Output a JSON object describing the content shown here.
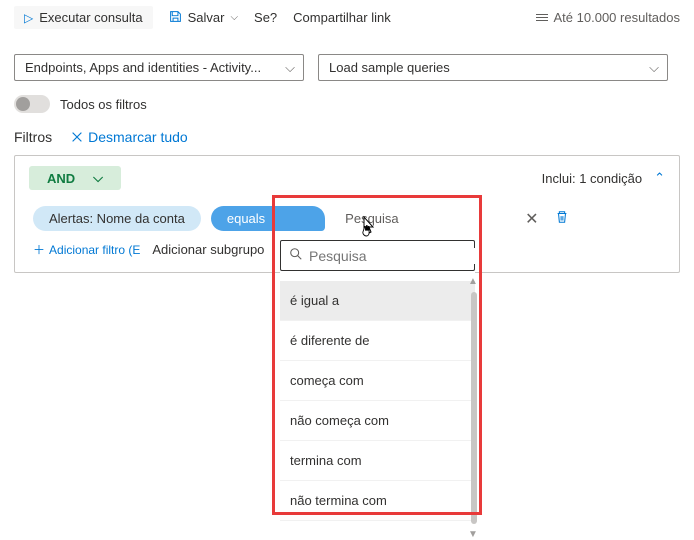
{
  "toolbar": {
    "run_query": "Executar consulta",
    "save": "Salvar",
    "se": "Se?",
    "share_link": "Compartilhar link",
    "results_limit": "Até 10.000 resultados"
  },
  "dropdowns": {
    "scope": "Endpoints, Apps and identities - Activity...",
    "sample_queries": "Load sample queries"
  },
  "filters": {
    "toggle_label": "Todos os filtros",
    "label": "Filtros",
    "deselect_all": "Desmarcar tudo",
    "and_label": "AND",
    "inclusion_text": "Inclui: 1 condição",
    "field_pill": "Alertas: Nome da conta",
    "operator_label": "equals",
    "value_placeholder": "Pesquisa",
    "add_filter": "Adicionar filtro (E",
    "add_subgroup": "Adicionar subgrupo"
  },
  "operator_dropdown": {
    "search_placeholder": "Pesquisa",
    "options": [
      "é igual a",
      "é diferente de",
      "começa com",
      "não começa com",
      "termina com",
      "não termina com"
    ],
    "selected_index": 0
  }
}
